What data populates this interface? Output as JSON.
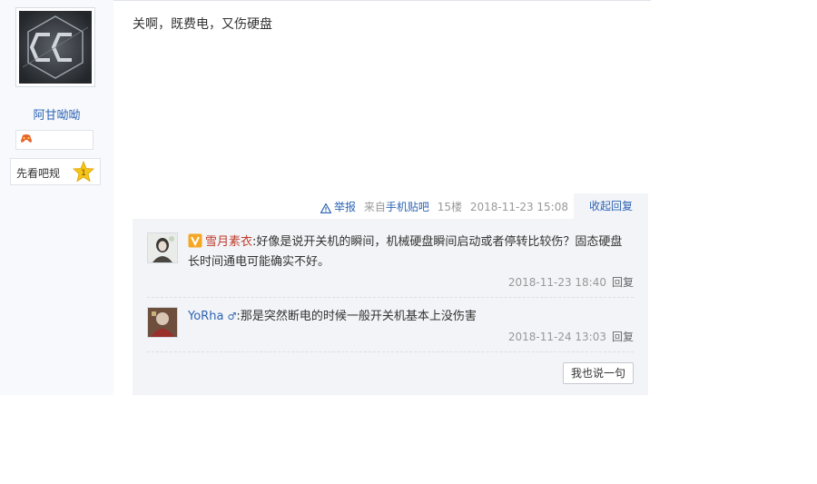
{
  "user": {
    "name": "阿甘呦呦",
    "rules_label": "先看吧规",
    "rules_badge": "1"
  },
  "post": {
    "content": "关啊，既费电，又伤硬盘",
    "report_label": "举报",
    "source_prefix": "来自",
    "source_link": "手机贴吧",
    "floor": "15楼",
    "time": "2018-11-23 15:08",
    "collapse_label": "收起回复"
  },
  "replies": [
    {
      "user": "雪月素衣",
      "colon": ":",
      "text": "好像是说开关机的瞬间，机械硬盘瞬间启动或者停转比较伤？固态硬盘长时间通电可能确实不好。",
      "time": "2018-11-23 18:40",
      "reply_label": "回复"
    },
    {
      "user": "YoRha",
      "gender": "♂",
      "colon": ":",
      "text": "那是突然断电的时候一般开关机基本上没伤害",
      "time": "2018-11-24 13:03",
      "reply_label": "回复"
    }
  ],
  "say_button": "我也说一句",
  "colors": {
    "link": "#2d64b3",
    "vip_name": "#c0392b",
    "panel_bg": "#f2f4f7",
    "left_bg": "#f7f9fc"
  }
}
